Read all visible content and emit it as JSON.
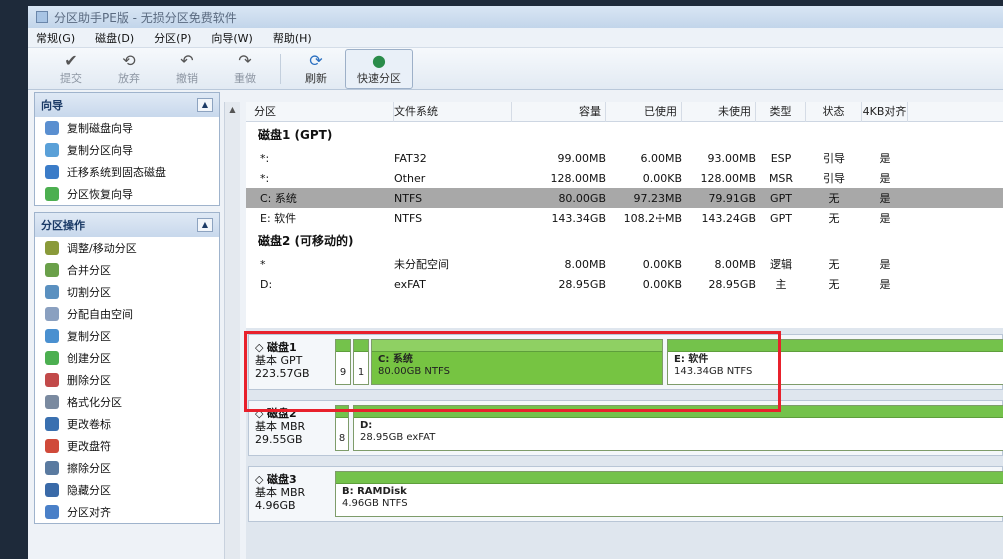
{
  "window": {
    "title": "分区助手PE版 - 无损分区免费软件"
  },
  "menu": [
    "常规(G)",
    "磁盘(D)",
    "分区(P)",
    "向导(W)",
    "帮助(H)"
  ],
  "toolbar": {
    "commit": "提交",
    "discard": "放弃",
    "undo": "撤销",
    "redo": "重做",
    "refresh": "刷新",
    "quick_partition": "快速分区"
  },
  "wizard_panel": {
    "title": "向导",
    "items": [
      "复制磁盘向导",
      "复制分区向导",
      "迁移系统到固态磁盘",
      "分区恢复向导"
    ]
  },
  "ops_panel": {
    "title": "分区操作",
    "items": [
      "调整/移动分区",
      "合并分区",
      "切割分区",
      "分配自由空间",
      "复制分区",
      "创建分区",
      "删除分区",
      "格式化分区",
      "更改卷标",
      "更改盘符",
      "擦除分区",
      "隐藏分区",
      "分区对齐"
    ]
  },
  "columns": [
    "分区",
    "文件系统",
    "容量",
    "已使用",
    "未使用",
    "类型",
    "状态",
    "4KB对齐"
  ],
  "disks": [
    {
      "header": "磁盘1 (GPT)",
      "rows": [
        [
          "*:",
          "FAT32",
          "99.00MB",
          "6.00MB",
          "93.00MB",
          "ESP",
          "引导",
          "是"
        ],
        [
          "*:",
          "Other",
          "128.00MB",
          "0.00KB",
          "128.00MB",
          "MSR",
          "引导",
          "是"
        ],
        [
          "C: 系统",
          "NTFS",
          "80.00GB",
          "97.23MB",
          "79.91GB",
          "GPT",
          "无",
          "是"
        ],
        [
          "E: 软件",
          "NTFS",
          "143.34GB",
          "108.2☩MB",
          "143.24GB",
          "GPT",
          "无",
          "是"
        ]
      ]
    },
    {
      "header": "磁盘2 (可移动的)",
      "rows": [
        [
          "*",
          "未分配空间",
          "8.00MB",
          "0.00KB",
          "8.00MB",
          "逻辑",
          "无",
          "是"
        ],
        [
          "D:",
          "exFAT",
          "28.95GB",
          "0.00KB",
          "28.95GB",
          "主",
          "无",
          "是"
        ]
      ]
    }
  ],
  "map": {
    "disk1": {
      "name": "磁盘1",
      "type": "基本 GPT",
      "size": "223.57GB",
      "small1": "9",
      "small2": "1",
      "c_name": "C: 系统",
      "c_info": "80.00GB NTFS",
      "e_name": "E: 软件",
      "e_info": "143.34GB NTFS"
    },
    "disk2": {
      "name": "磁盘2",
      "type": "基本 MBR",
      "size": "29.55GB",
      "small": "8",
      "d_name": "D:",
      "d_info": "28.95GB exFAT"
    },
    "disk3": {
      "name": "磁盘3",
      "type": "基本 MBR",
      "size": "4.96GB",
      "b_name": "B: RAMDisk",
      "b_info": "4.96GB NTFS"
    }
  }
}
